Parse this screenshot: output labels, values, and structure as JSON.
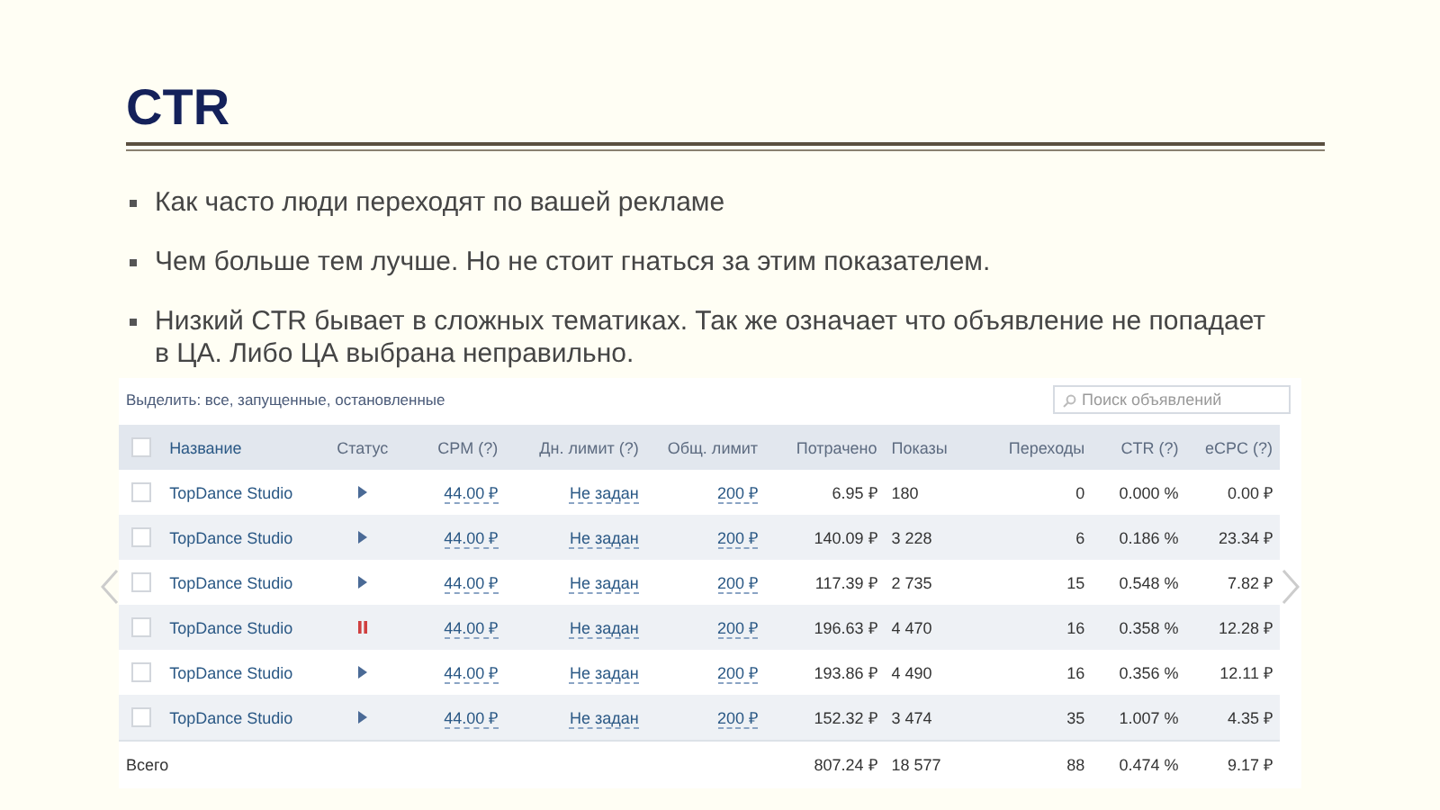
{
  "title": "CTR",
  "bullets": [
    "Как часто люди переходят по вашей рекламе",
    "Чем больше тем лучше. Но не стоит гнаться за этим показателем.",
    "Низкий CTR бывает в сложных тематиках. Так же означает что объявление не попадает в ЦА. Либо ЦА выбрана неправильно."
  ],
  "screenshot": {
    "filter": "Выделить: все, запущенные, остановленные",
    "search": {
      "placeholder": "Поиск объявлений"
    },
    "select_all": {
      "checked": false
    },
    "columns": [
      "Название",
      "Статус",
      "CPM (?)",
      "Дн. лимит (?)",
      "Общ. лимит",
      "Потрачено",
      "Показы",
      "Переходы",
      "CTR (?)",
      "eCPC (?)"
    ],
    "rows": [
      {
        "checked": false,
        "name": "TopDance Studio",
        "paused": false,
        "cpm": "44.00 ₽",
        "day_limit": "Не задан",
        "total_limit": "200 ₽",
        "spent": "6.95 ₽",
        "views": "180",
        "clicks": "0",
        "ctr": "0.000 %",
        "ecpc": "0.00 ₽"
      },
      {
        "checked": false,
        "name": "TopDance Studio",
        "paused": false,
        "cpm": "44.00 ₽",
        "day_limit": "Не задан",
        "total_limit": "200 ₽",
        "spent": "140.09 ₽",
        "views": "3 228",
        "clicks": "6",
        "ctr": "0.186 %",
        "ecpc": "23.34 ₽"
      },
      {
        "checked": false,
        "name": "TopDance Studio",
        "paused": false,
        "cpm": "44.00 ₽",
        "day_limit": "Не задан",
        "total_limit": "200 ₽",
        "spent": "117.39 ₽",
        "views": "2 735",
        "clicks": "15",
        "ctr": "0.548 %",
        "ecpc": "7.82 ₽"
      },
      {
        "checked": false,
        "name": "TopDance Studio",
        "paused": true,
        "cpm": "44.00 ₽",
        "day_limit": "Не задан",
        "total_limit": "200 ₽",
        "spent": "196.63 ₽",
        "views": "4 470",
        "clicks": "16",
        "ctr": "0.358 %",
        "ecpc": "12.28 ₽"
      },
      {
        "checked": false,
        "name": "TopDance Studio",
        "paused": false,
        "cpm": "44.00 ₽",
        "day_limit": "Не задан",
        "total_limit": "200 ₽",
        "spent": "193.86 ₽",
        "views": "4 490",
        "clicks": "16",
        "ctr": "0.356 %",
        "ecpc": "12.11 ₽"
      },
      {
        "checked": false,
        "name": "TopDance Studio",
        "paused": false,
        "cpm": "44.00 ₽",
        "day_limit": "Не задан",
        "total_limit": "200 ₽",
        "spent": "152.32 ₽",
        "views": "3 474",
        "clicks": "35",
        "ctr": "1.007 %",
        "ecpc": "4.35 ₽"
      }
    ],
    "total": {
      "label": "Всего",
      "spent": "807.24 ₽",
      "views": "18 577",
      "clicks": "88",
      "ctr": "0.474 %",
      "ecpc": "9.17 ₽"
    }
  }
}
